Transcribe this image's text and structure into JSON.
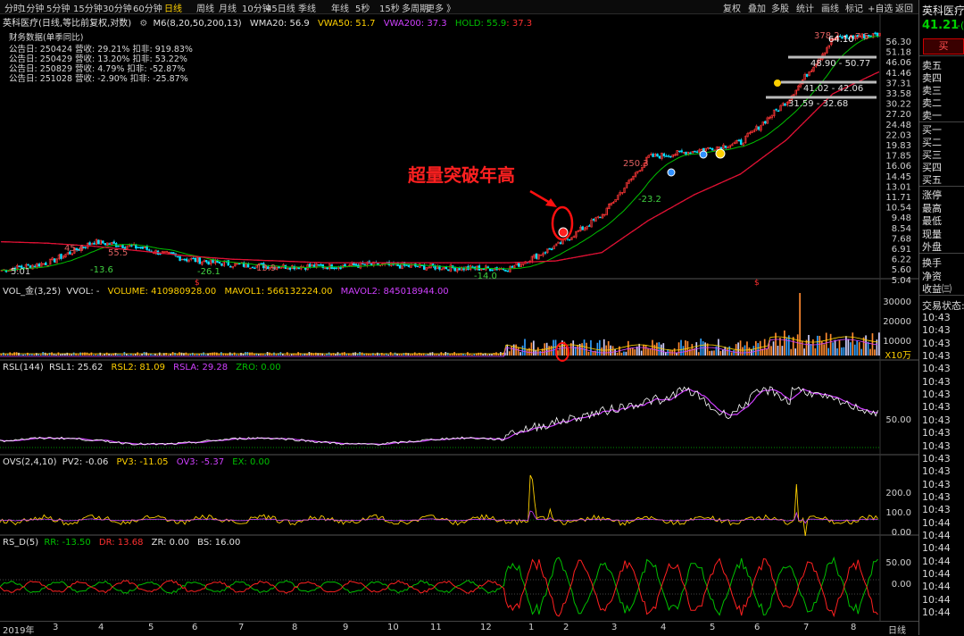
{
  "toolbar": {
    "periods": [
      "分时",
      "1分钟",
      "5分钟",
      "15分钟",
      "30分钟",
      "60分钟",
      "日线",
      "周线",
      "月线",
      "10分钟",
      "45日线",
      "季线",
      "年线",
      "5秒",
      "15秒",
      "多周期",
      "更多 》"
    ],
    "active_period": "日线",
    "right_tools": [
      "复权",
      "叠加",
      "多股",
      "统计",
      "画线",
      "标记",
      "+自选",
      "返回"
    ]
  },
  "main_title": {
    "stock": "英科医疗(日线,等比前复权,对数)",
    "indicator_name": "M6(8,20,50,200,13)",
    "wma20": "WMA20: 56.9",
    "vwa50": "VWA50: 51.7",
    "vwa200": "VWA200: 37.3",
    "hold": "HOLD: 55.9",
    "hold2": ": 37.3"
  },
  "financials": {
    "header": "财务数据(单季同比)",
    "rows": [
      "公告日: 250424   营收:  29.21%     扣非:  919.83%",
      "公告日: 250429   营收:  13.20%     扣非:  53.22%",
      "公告日: 250829   营收:   4.79%     扣非:  -52.87%",
      "公告日: 251028   营收:  -2.90%     扣非:  -25.87%"
    ]
  },
  "annotation": "超量突破年高",
  "price_labels": {
    "p45": "45.4",
    "p13_6": "-13.6",
    "p55": "55.5",
    "p26": "-26.1",
    "p13_9": "13.9",
    "p14": "-14.0",
    "p5": "5.01",
    "p250": "250.3",
    "p23": "-23.2",
    "p378": "378.2",
    "p64": "64.10",
    "p7": "7.5",
    "z1": "48.90 - 50.77",
    "z2": "41.02 - 42.06",
    "z3": "31.59 - 32.68",
    "dollar": "$"
  },
  "price_axis": [
    "56.30",
    "51.18",
    "46.06",
    "41.46",
    "37.31",
    "33.58",
    "30.22",
    "27.20",
    "24.48",
    "22.03",
    "19.83",
    "17.85",
    "16.06",
    "14.45",
    "13.01",
    "11.71",
    "10.54",
    "9.48",
    "8.54",
    "7.68",
    "6.91",
    "6.22",
    "5.60",
    "5.04"
  ],
  "vol_panel": {
    "title": "VOL_金(3,25)",
    "vvol": "VVOL: -",
    "volume": "VOLUME: 410980928.00",
    "mavol1": "MAVOL1: 566132224.00",
    "mavol2": "MAVOL2: 845018944.00",
    "axis": [
      "30000",
      "20000",
      "10000"
    ],
    "unit": "X10万"
  },
  "rsl_panel": {
    "title": "RSL(144)",
    "rsl1": "RSL1: 25.62",
    "rsl2": "RSL2: 81.09",
    "rsla": "RSLA: 29.28",
    "zro": "ZRO: 0.00",
    "axis": [
      "50.00"
    ]
  },
  "ovs_panel": {
    "title": "OVS(2,4,10)",
    "pv2": "PV2: -0.06",
    "pv3": "PV3: -11.05",
    "ov3": "OV3: -5.37",
    "ex": "EX: 0.00",
    "axis": [
      "200.0",
      "100.0",
      "0.00"
    ]
  },
  "rsd_panel": {
    "title": "RS_D(5)",
    "rr": "RR: -13.50",
    "dr": "DR: 13.68",
    "zr": "ZR: 0.00",
    "bs": "BS: 16.00",
    "axis": [
      "50.00",
      "0.00"
    ]
  },
  "x_axis": [
    "2019年",
    "3",
    "4",
    "5",
    "6",
    "7",
    "8",
    "9",
    "10",
    "11",
    "12",
    "1",
    "2",
    "3",
    "4",
    "5",
    "6",
    "7",
    "8"
  ],
  "bottom_right": "日线",
  "right_panel": {
    "name": "英科医疗",
    "price": "41.21",
    "change": "-(",
    "buy": "买",
    "asks": [
      "卖五",
      "卖四",
      "卖三",
      "卖二",
      "卖一"
    ],
    "bids": [
      "买一",
      "买二",
      "买三",
      "买四",
      "买五"
    ],
    "stats": [
      "涨停",
      "最高",
      "最低",
      "现量",
      "外盘"
    ],
    "more": [
      "换手",
      "净资",
      "收益㈢"
    ],
    "trade_status": "交易状态:",
    "times": [
      "10:43",
      "10:43",
      "10:43",
      "10:43",
      "10:43",
      "10:43",
      "10:43",
      "10:43",
      "10:43",
      "10:43",
      "10:43",
      "10:43",
      "10:43",
      "10:43",
      "10:43",
      "10:43",
      "10:44",
      "10:44",
      "10:44",
      "10:44",
      "10:44",
      "10:44",
      "10:44",
      "10:44"
    ]
  },
  "colors": {
    "up": "#ff3232",
    "down": "#00e0ff",
    "green": "#00c000",
    "yellow": "#ffd000",
    "purple": "#c040ff",
    "white": "#ffffff",
    "red_line": "#e01030"
  },
  "chart_data": [
    {
      "type": "line",
      "title": "英科医疗(日线,等比前复权,对数)",
      "note_series": "approximate daily close path (log price)",
      "x": [
        "2019-01",
        "2019-02",
        "2019-03",
        "2019-04",
        "2019-05",
        "2019-06",
        "2019-07",
        "2019-08",
        "2019-09",
        "2019-10",
        "2019-11",
        "2019-12",
        "2020-01",
        "2020-02",
        "2020-03",
        "2020-04",
        "2020-05",
        "2020-06",
        "2020-07",
        "2020-08"
      ],
      "series": [
        {
          "name": "price",
          "values": [
            5.2,
            5.6,
            6.9,
            6.5,
            5.8,
            5.5,
            5.4,
            5.4,
            5.5,
            5.4,
            5.3,
            5.3,
            6.6,
            9.0,
            16.0,
            17.0,
            18.5,
            28.0,
            52.0,
            54.0
          ]
        },
        {
          "name": "VWA200",
          "values": [
            6.9,
            6.8,
            6.6,
            6.3,
            6.0,
            5.8,
            5.7,
            5.6,
            5.6,
            5.6,
            5.6,
            5.6,
            5.7,
            6.2,
            8.5,
            11.0,
            13.5,
            19.0,
            30.0,
            37.3
          ]
        }
      ],
      "ylim": [
        5.04,
        56.3
      ],
      "yscale": "log"
    },
    {
      "type": "bar",
      "title": "VOL_金(3,25)",
      "ylim": [
        0,
        35000
      ],
      "unit": "X10万"
    }
  ]
}
